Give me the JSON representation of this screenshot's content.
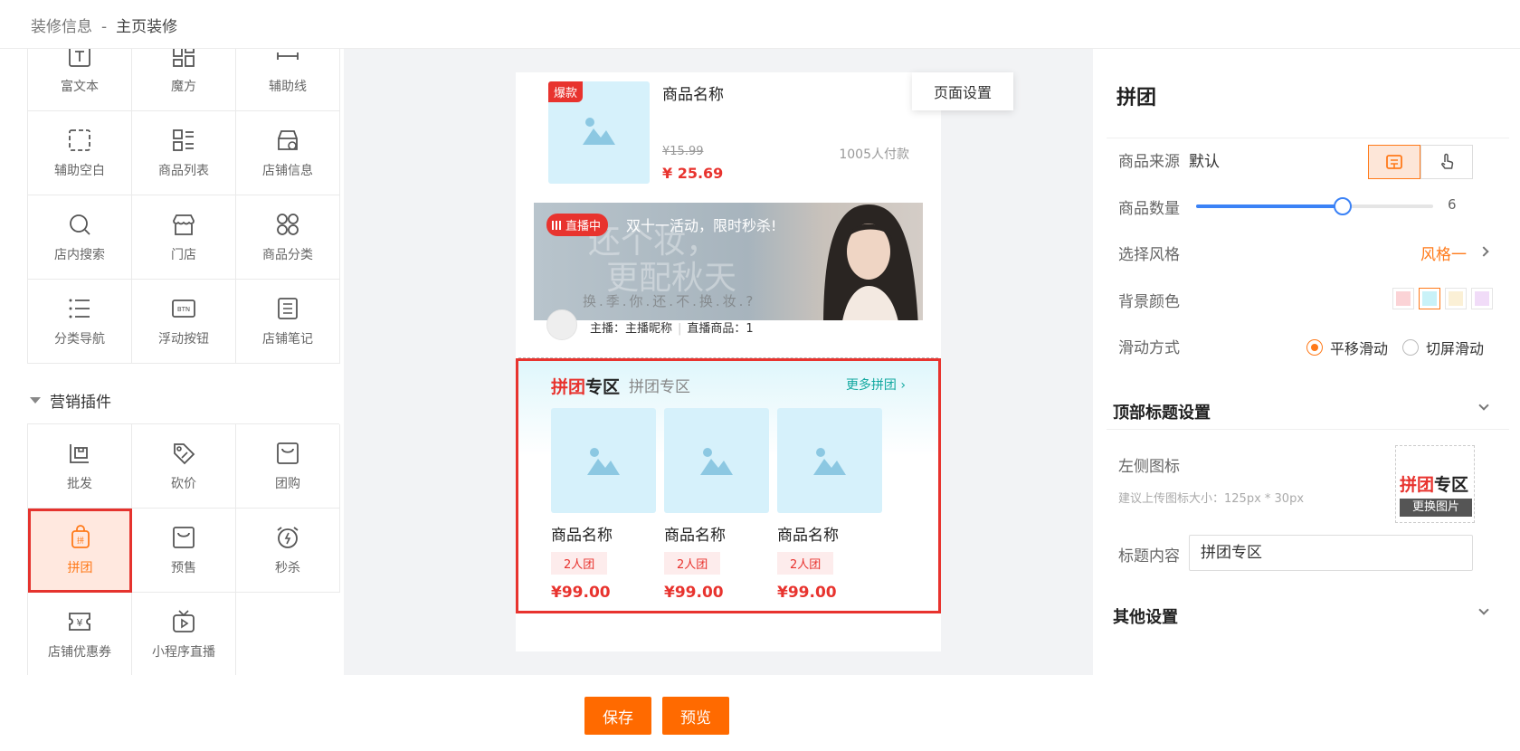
{
  "breadcrumb": {
    "root": "装修信息",
    "sep": "-",
    "current": "主页装修"
  },
  "components_top": [
    {
      "label": "富文本",
      "icon": "rich-text-icon"
    },
    {
      "label": "魔方",
      "icon": "cube-icon"
    },
    {
      "label": "辅助线",
      "icon": "divider-line-icon"
    },
    {
      "label": "辅助空白",
      "icon": "blank-space-icon"
    },
    {
      "label": "商品列表",
      "icon": "product-list-icon"
    },
    {
      "label": "店铺信息",
      "icon": "store-info-icon"
    },
    {
      "label": "店内搜索",
      "icon": "search-icon"
    },
    {
      "label": "门店",
      "icon": "shop-icon"
    },
    {
      "label": "商品分类",
      "icon": "category-icon"
    },
    {
      "label": "分类导航",
      "icon": "list-nav-icon"
    },
    {
      "label": "浮动按钮",
      "icon": "btn-icon"
    },
    {
      "label": "店铺笔记",
      "icon": "notes-icon"
    }
  ],
  "marketing": {
    "section_label": "营销插件",
    "items": [
      {
        "label": "批发",
        "icon": "wholesale-icon"
      },
      {
        "label": "砍价",
        "icon": "bargain-tag-icon"
      },
      {
        "label": "团购",
        "icon": "group-buy-icon"
      },
      {
        "label": "拼团",
        "icon": "pintuan-icon",
        "selected": true
      },
      {
        "label": "预售",
        "icon": "presale-bag-icon"
      },
      {
        "label": "秒杀",
        "icon": "alarm-clock-icon"
      },
      {
        "label": "店铺优惠券",
        "icon": "coupon-icon"
      },
      {
        "label": "小程序直播",
        "icon": "tv-live-icon"
      }
    ]
  },
  "preview": {
    "page_settings": "页面设置",
    "goods": {
      "badge": "爆款",
      "name": "商品名称",
      "old_price": "¥15.99",
      "price": "¥ 25.69",
      "paid": "1005人付款"
    },
    "live": {
      "badge": "直播中",
      "title": "双十一活动，限时秒杀!",
      "bg_line1": "还个妆，",
      "bg_line2": "更配秋天",
      "bg_line3": "换.季.你.还.不.换.妆.?",
      "anchor_label": "主播：主播昵称",
      "goods_label": "直播商品：1"
    },
    "pintuan": {
      "logo_red": "拼团",
      "logo_black": "专区",
      "title": "拼团专区",
      "more": "更多拼团",
      "items": [
        {
          "name": "商品名称",
          "tag": "2人团",
          "price": "¥99.00"
        },
        {
          "name": "商品名称",
          "tag": "2人团",
          "price": "¥99.00"
        },
        {
          "name": "商品名称",
          "tag": "2人团",
          "price": "¥99.00"
        }
      ]
    }
  },
  "settings": {
    "title": "拼团",
    "source_label": "商品来源",
    "source_value": "默认",
    "count_label": "商品数量",
    "count_value": "6",
    "count_fraction": 0.62,
    "style_label": "选择风格",
    "style_value": "风格一",
    "bg_label": "背景颜色",
    "bg_colors": [
      "#fbd3d6",
      "#c9f2f8",
      "#fbf0d6",
      "#f1dcf8"
    ],
    "bg_selected": 1,
    "slide_label": "滑动方式",
    "slide_opt1": "平移滑动",
    "slide_opt2": "切屏滑动",
    "top_title_section": "顶部标题设置",
    "left_icon_label": "左侧图标",
    "icon_hint": "建议上传图标大小：125px * 30px",
    "change_image": "更换图片",
    "logo_red": "拼团",
    "logo_black": "专区",
    "title_content_label": "标题内容",
    "title_content_value": "拼团专区",
    "other_section": "其他设置"
  },
  "footer": {
    "save": "保存",
    "preview": "预览"
  },
  "colors": {
    "accent": "#ff6a00",
    "red": "#e8332e",
    "teal": "#12a8a0",
    "slider": "#3b82f6"
  }
}
